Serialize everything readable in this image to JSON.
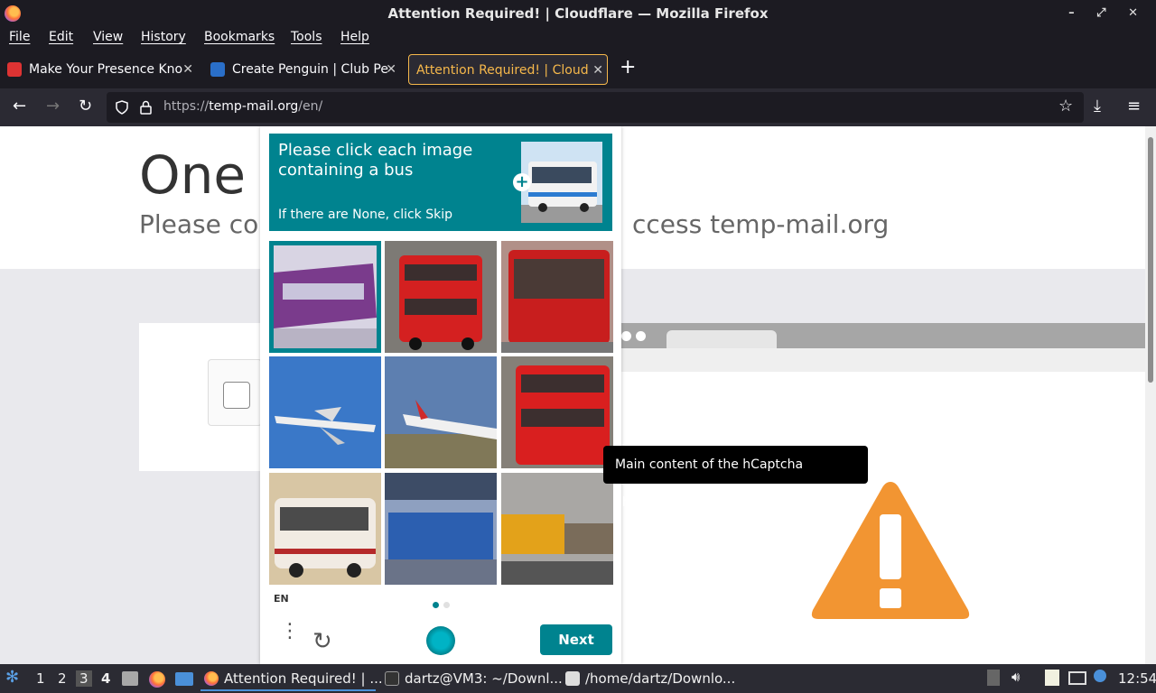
{
  "window": {
    "title": "Attention Required! | Cloudflare — Mozilla Firefox",
    "controls": "– ⤢ ✕"
  },
  "menu": [
    "File",
    "Edit",
    "View",
    "History",
    "Bookmarks",
    "Tools",
    "Help"
  ],
  "tabs": [
    {
      "label": "Make Your Presence Kno",
      "close": "✕",
      "active": false
    },
    {
      "label": "Create Penguin | Club Pe",
      "close": "✕",
      "active": false
    },
    {
      "label": "Attention Required! | Cloudfl",
      "close": "✕",
      "active": true
    }
  ],
  "newtab": "+",
  "nav": {
    "back": "←",
    "forward": "→",
    "reload": "↻",
    "url_prefix": "https://",
    "url_host": "temp-mail.org",
    "url_path": "/en/",
    "bookmark": "☆",
    "download": "⤓",
    "menu": "≡"
  },
  "page": {
    "heading": "One",
    "subtext_left": "Please cor",
    "subtext_right": "ccess temp-mail.org"
  },
  "captcha": {
    "prompt": "Please click each image containing a bus",
    "hint": "If there are None, click Skip",
    "sample_plus": "+",
    "lang": "EN",
    "next_label": "Next",
    "menu_glyph": "⋮",
    "refresh_glyph": "↻",
    "tiles": [
      {
        "subject": "purple train",
        "selected": true
      },
      {
        "subject": "red double-decker bus",
        "selected": false
      },
      {
        "subject": "red bus",
        "selected": false
      },
      {
        "subject": "airplane",
        "selected": false
      },
      {
        "subject": "airplane",
        "selected": false
      },
      {
        "subject": "red double-decker bus",
        "selected": false
      },
      {
        "subject": "white bus",
        "selected": false
      },
      {
        "subject": "blue train",
        "selected": false
      },
      {
        "subject": "yellow train",
        "selected": false
      }
    ]
  },
  "tooltip": "Main content of the hCaptcha challenge",
  "taskbar": {
    "workspaces": [
      "1",
      "2",
      "3",
      "4"
    ],
    "active_workspace": "3",
    "tasks": [
      {
        "label": "Attention Required! | ...",
        "active": true
      },
      {
        "label": "dartz@VM3: ~/Downl...",
        "active": false
      },
      {
        "label": "/home/dartz/Downlo...",
        "active": false
      }
    ],
    "clock": "12:54"
  },
  "colors": {
    "captcha_teal": "#00838f",
    "active_tab": "#f6b84b",
    "warning": "#f29532"
  }
}
